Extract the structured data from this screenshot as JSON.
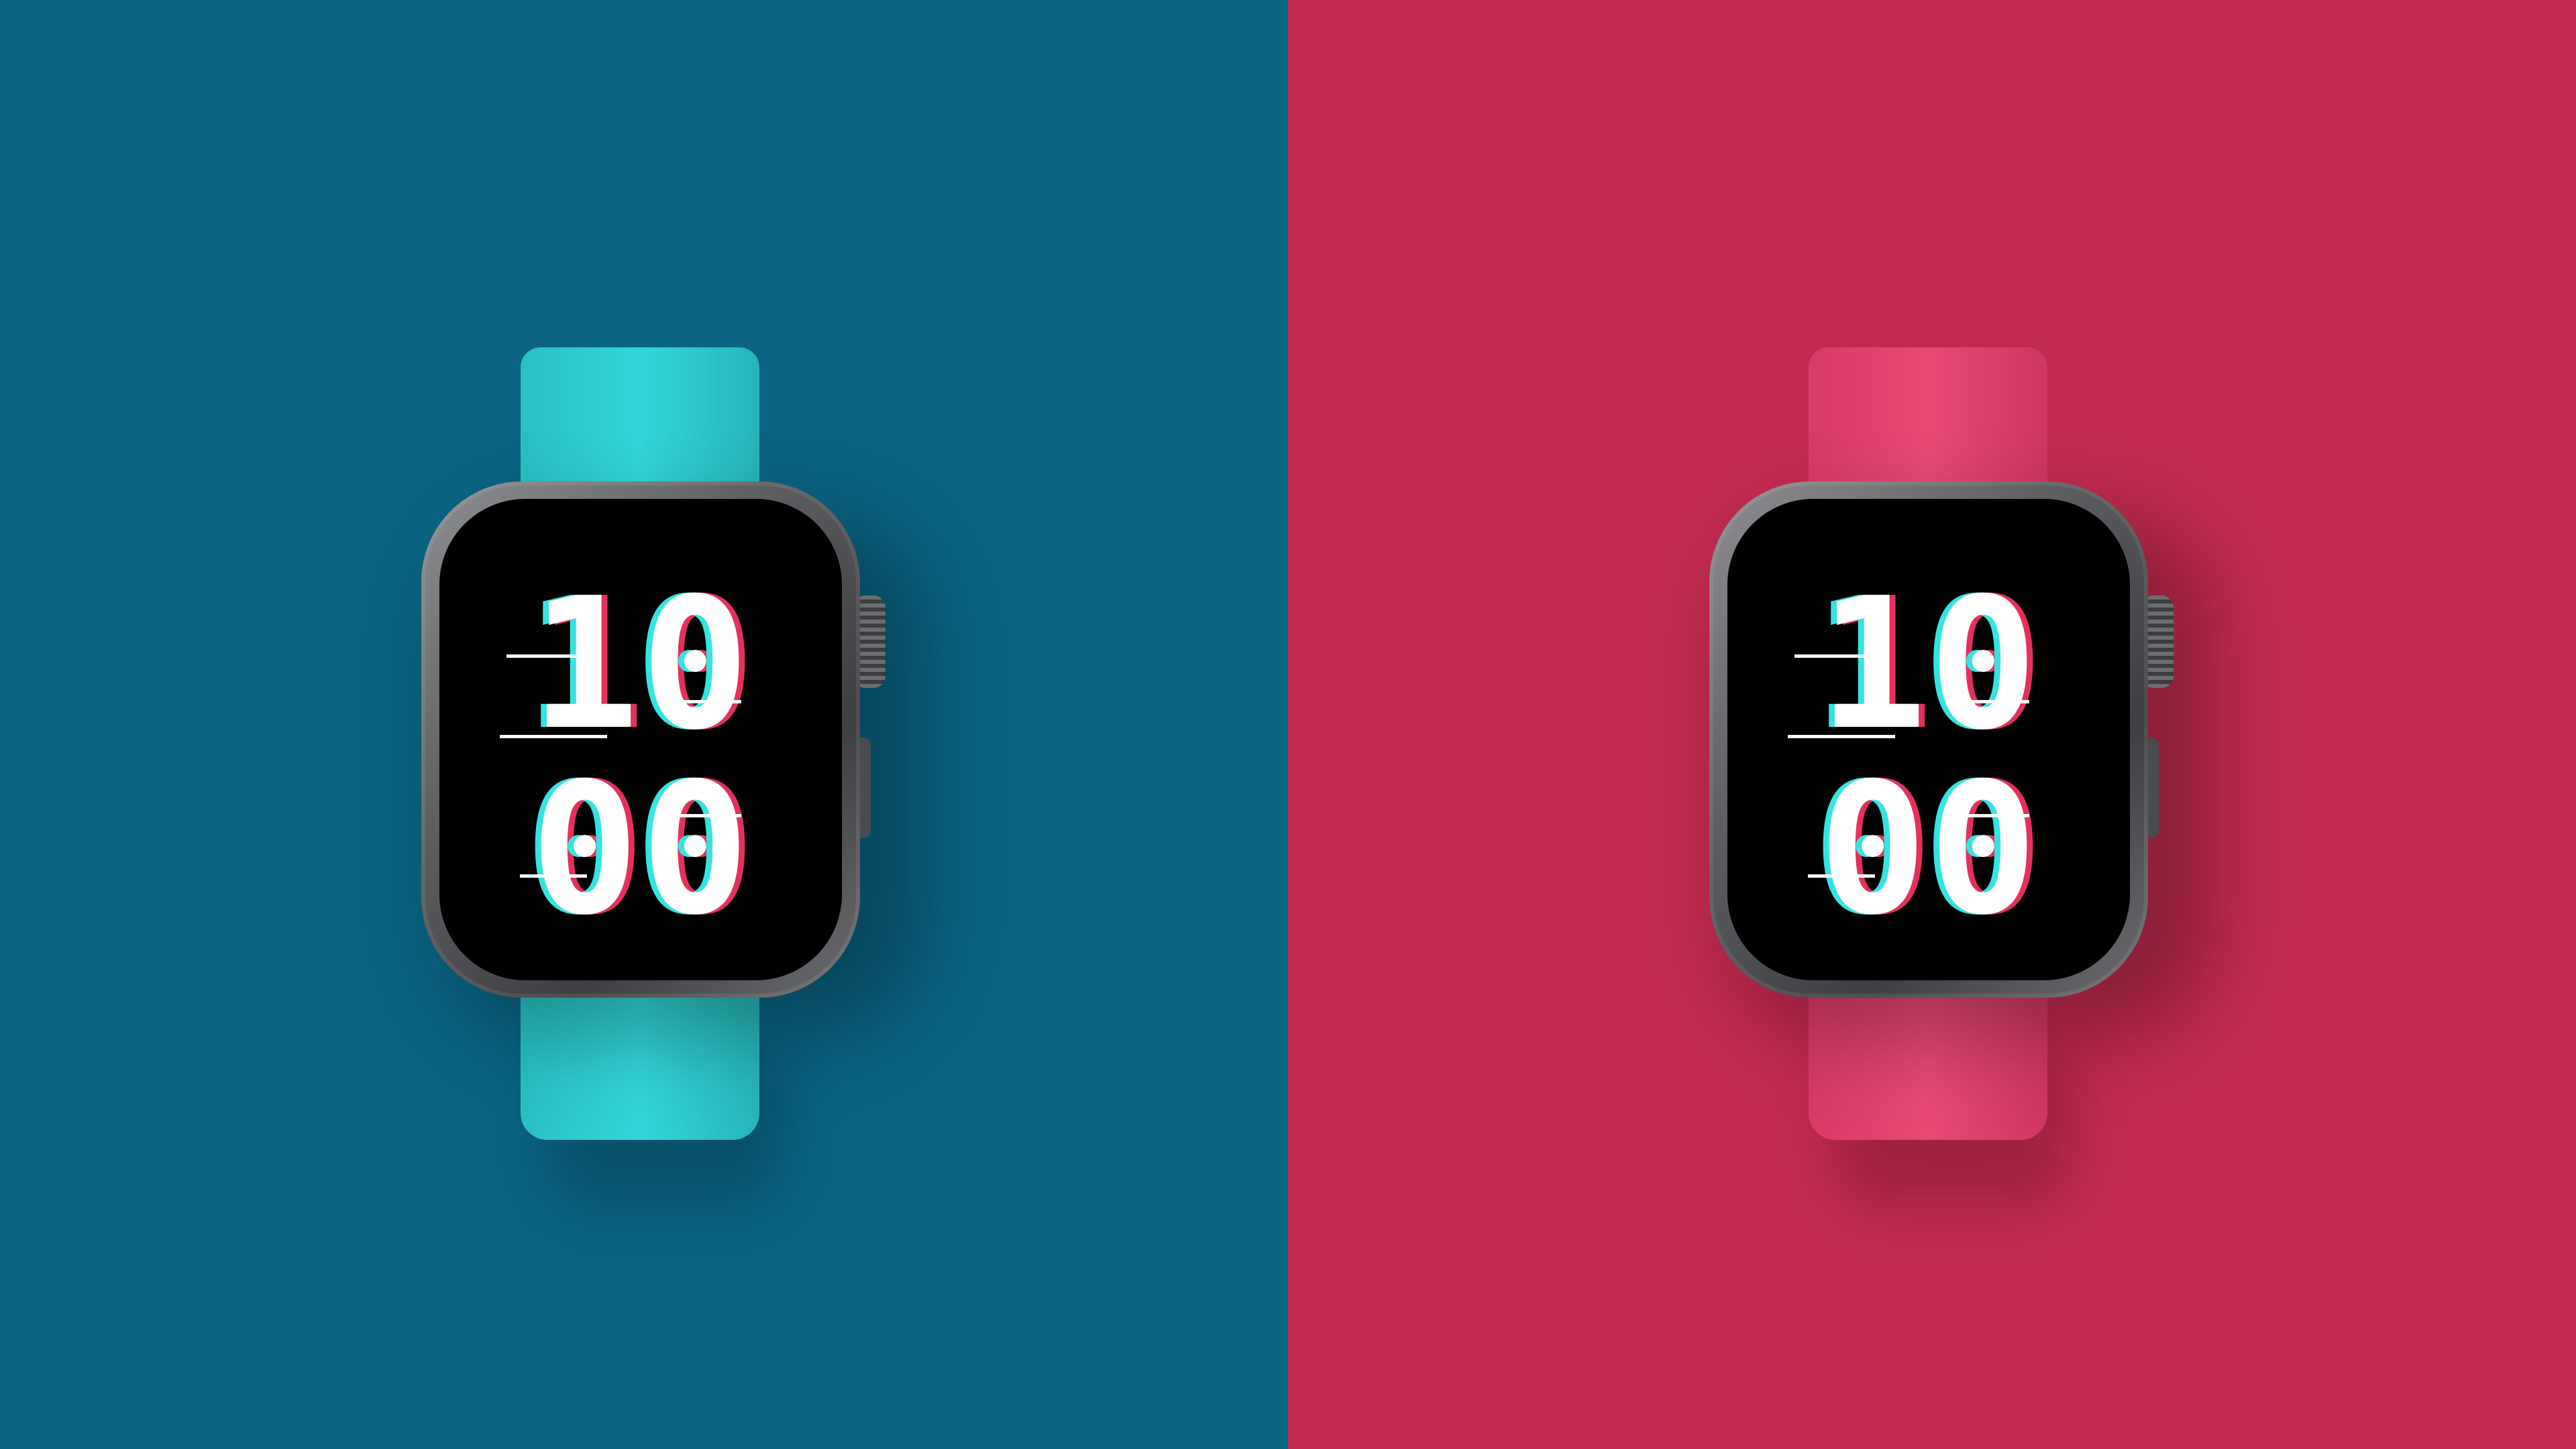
{
  "watches": [
    {
      "hours": "10",
      "minutes": "00",
      "background_color": "#0a6482",
      "band_color": "#2ed0d2"
    },
    {
      "hours": "10",
      "minutes": "00",
      "background_color": "#c22b4f",
      "band_color": "#e2456f"
    }
  ],
  "glitch_colors": {
    "cyan": "#35e4e0",
    "red": "#e4315c"
  }
}
